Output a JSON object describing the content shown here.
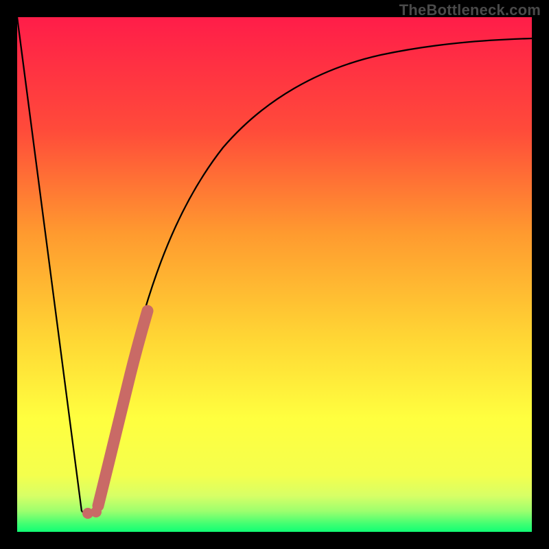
{
  "watermark": {
    "text": "TheBottleneck.com"
  },
  "chart_data": {
    "type": "line",
    "title": "",
    "xlabel": "",
    "ylabel": "",
    "xlim": [
      0,
      100
    ],
    "ylim": [
      0,
      100
    ],
    "grid": false,
    "series": [
      {
        "name": "left-descent",
        "color": "#000000",
        "x": [
          0,
          12.5
        ],
        "y": [
          100,
          4
        ]
      },
      {
        "name": "valley-floor",
        "color": "#000000",
        "x": [
          12.5,
          15.5
        ],
        "y": [
          4,
          4
        ]
      },
      {
        "name": "right-curve",
        "color": "#000000",
        "x": [
          15.5,
          18,
          20,
          22,
          24,
          27,
          30,
          34,
          40,
          46,
          54,
          64,
          76,
          88,
          100
        ],
        "y": [
          4,
          15,
          25,
          33,
          41,
          50,
          58,
          66,
          75,
          81,
          86,
          90,
          92.5,
          94,
          95
        ]
      },
      {
        "name": "highlight-band",
        "color": "#c96a66",
        "x": [
          15.5,
          24.5
        ],
        "y": [
          5,
          42
        ]
      }
    ],
    "background_gradient": {
      "top": "#ff1d49",
      "mid1": "#ff7b2f",
      "mid2": "#ffd534",
      "mid3": "#ffff3f",
      "lowband": "#e4ff5e",
      "bottom": "#11ff74"
    },
    "highlight_dots": [
      {
        "x": 13.8,
        "y": 5
      },
      {
        "x": 15.3,
        "y": 5
      }
    ]
  }
}
